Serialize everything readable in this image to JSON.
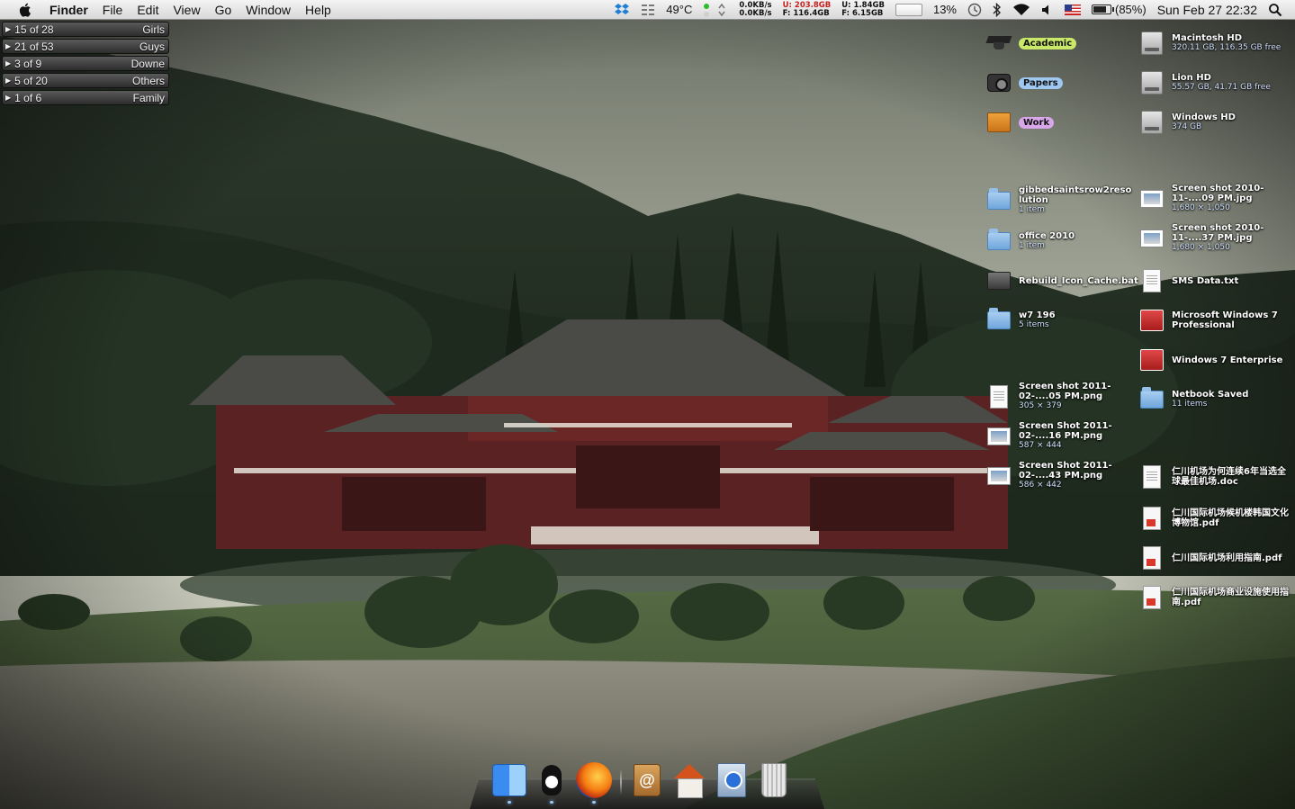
{
  "menubar": {
    "app_name": "Finder",
    "menus": [
      "File",
      "Edit",
      "View",
      "Go",
      "Window",
      "Help"
    ],
    "temperature": "49°C",
    "net_down": "0.0KB/s",
    "net_up": "0.0KB/s",
    "disk_u1": "U:",
    "disk_u1_val": "203.8GB",
    "disk_f1": "F:",
    "disk_f1_val": "116.4GB",
    "mem_u": "U:",
    "mem_u_val": "1.84GB",
    "mem_f": "F:",
    "mem_f_val": "6.15GB",
    "cpu_percent": "13%",
    "battery_percent": "(85%)",
    "battery_level": 0.85,
    "clock": "Sun Feb 27  22:32"
  },
  "counters": [
    {
      "count": "15 of 28",
      "label": "Girls"
    },
    {
      "count": "21 of 53",
      "label": "Guys"
    },
    {
      "count": "3 of 9",
      "label": "Downe"
    },
    {
      "count": "5 of 20",
      "label": "Others"
    },
    {
      "count": "1 of 6",
      "label": "Family"
    }
  ],
  "desktop": {
    "left_column": [
      {
        "name": "Academic",
        "sub": "",
        "tag": "green",
        "icon": "graduation-cap-icon"
      },
      {
        "name": "Papers",
        "sub": "",
        "tag": "blue",
        "icon": "camera-icon"
      },
      {
        "name": "Work",
        "sub": "",
        "tag": "purple",
        "icon": "package-icon"
      },
      {
        "name": "gibbedsaintsrow2resolution",
        "sub": "1 item",
        "tag": "",
        "icon": "folder-icon"
      },
      {
        "name": "office 2010",
        "sub": "1 item",
        "tag": "",
        "icon": "folder-icon"
      },
      {
        "name": "Rebuild_Icon_Cache.bat",
        "sub": "",
        "tag": "",
        "icon": "batch-file-icon"
      },
      {
        "name": "w7 196",
        "sub": "5 items",
        "tag": "",
        "icon": "folder-icon"
      },
      {
        "name": "Screen shot 2011-02-....05 PM.png",
        "sub": "305 × 379",
        "tag": "",
        "icon": "image-file-icon"
      },
      {
        "name": "Screen Shot 2011-02-....16 PM.png",
        "sub": "587 × 444",
        "tag": "",
        "icon": "image-file-icon"
      },
      {
        "name": "Screen Shot 2011-02-....43 PM.png",
        "sub": "586 × 442",
        "tag": "",
        "icon": "image-file-icon"
      }
    ],
    "right_column": [
      {
        "name": "Macintosh HD",
        "sub": "320.11 GB, 116.35 GB free",
        "icon": "hard-drive-icon"
      },
      {
        "name": "Lion HD",
        "sub": "55.57 GB, 41.71 GB free",
        "icon": "hard-drive-icon"
      },
      {
        "name": "Windows HD",
        "sub": "374 GB",
        "icon": "hard-drive-icon"
      },
      {
        "name": "Screen shot 2010-11-....09 PM.jpg",
        "sub": "1,680 × 1,050",
        "icon": "image-file-icon"
      },
      {
        "name": "Screen shot 2010-11-....37 PM.jpg",
        "sub": "1,680 × 1,050",
        "icon": "image-file-icon"
      },
      {
        "name": "SMS Data.txt",
        "sub": "",
        "icon": "text-file-icon"
      },
      {
        "name": "Microsoft Windows 7 Professional",
        "sub": "",
        "icon": "parallels-vm-icon"
      },
      {
        "name": "Windows 7 Enterprise",
        "sub": "",
        "icon": "parallels-vm-icon"
      },
      {
        "name": "Netbook Saved",
        "sub": "11 items",
        "icon": "folder-icon"
      },
      {
        "name": "仁川机场为何连续6年当选全球最佳机场.doc",
        "sub": "",
        "icon": "word-doc-icon"
      },
      {
        "name": "仁川国际机场候机楼韩国文化博物馆.pdf",
        "sub": "",
        "icon": "pdf-file-icon"
      },
      {
        "name": "仁川国际机场利用指南.pdf",
        "sub": "",
        "icon": "pdf-file-icon"
      },
      {
        "name": "仁川国际机场商业设施使用指南.pdf",
        "sub": "",
        "icon": "pdf-file-icon"
      }
    ]
  },
  "dock": [
    "finder-icon",
    "qq-penguin-icon",
    "firefox-icon",
    "address-book-icon",
    "home-folder-icon",
    "avi-file-icon",
    "trash-icon"
  ]
}
